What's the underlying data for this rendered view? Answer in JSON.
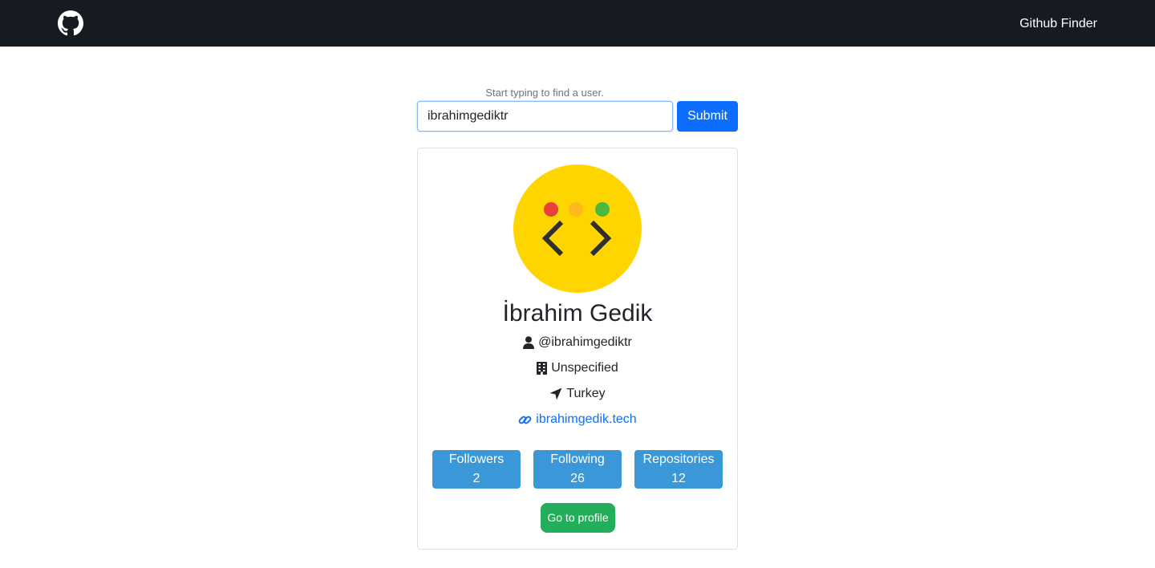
{
  "navbar": {
    "logo_icon": "github-icon",
    "title": "Github Finder"
  },
  "search": {
    "hint": "Start typing to find a user.",
    "value": "ibrahimgediktr",
    "submit_label": "Submit"
  },
  "profile": {
    "name": "İbrahim Gedik",
    "username": "@ibrahimgediktr",
    "company": "Unspecified",
    "location": "Turkey",
    "blog": "ibrahimgedik.tech",
    "stats": {
      "followers_label": "Followers",
      "followers_value": "2",
      "following_label": "Following",
      "following_value": "26",
      "repos_label": "Repositories",
      "repos_value": "12"
    },
    "go_to_profile_label": "Go to profile"
  },
  "colors": {
    "navbar_bg": "#161b22",
    "primary": "#0d6efd",
    "stat_bg": "#3a98d9",
    "success": "#24ad5a",
    "avatar_bg": "#ffd500"
  },
  "icons": {
    "username": "user-icon",
    "company": "building-icon",
    "location": "location-arrow-icon",
    "blog": "link-icon"
  }
}
